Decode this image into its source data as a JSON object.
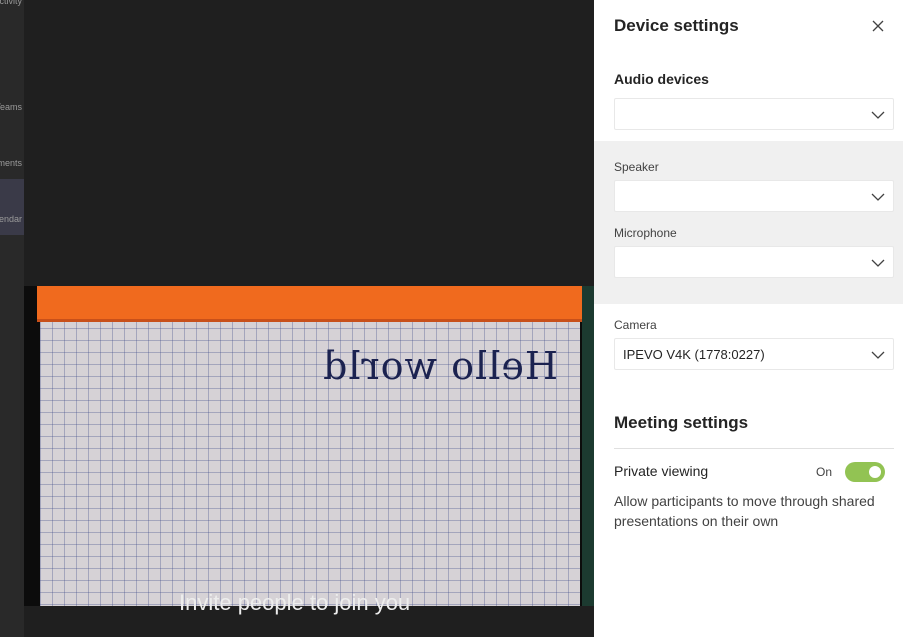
{
  "rail": {
    "items": [
      {
        "label": "Activity"
      },
      {
        "label": "Teams"
      },
      {
        "label": "Assignments"
      },
      {
        "label": "Calendar"
      }
    ]
  },
  "stage": {
    "invite_text": "Invite people to join you",
    "handwriting": "Hello world"
  },
  "panel": {
    "title": "Device settings",
    "audio_devices_label": "Audio devices",
    "audio_devices_value": "",
    "speaker_label": "Speaker",
    "speaker_value": "",
    "microphone_label": "Microphone",
    "microphone_value": "",
    "camera_label": "Camera",
    "camera_value": "IPEVO V4K (1778:0227)",
    "meeting_settings_label": "Meeting settings",
    "private_viewing_label": "Private viewing",
    "private_viewing_state": "On",
    "private_viewing_desc": "Allow participants to move through shared presentations on their own"
  },
  "colors": {
    "toggle_on": "#92c353",
    "pad_orange": "#f06a1e",
    "panel_bg": "#ffffff",
    "stage_bg": "#1f1f1f"
  }
}
